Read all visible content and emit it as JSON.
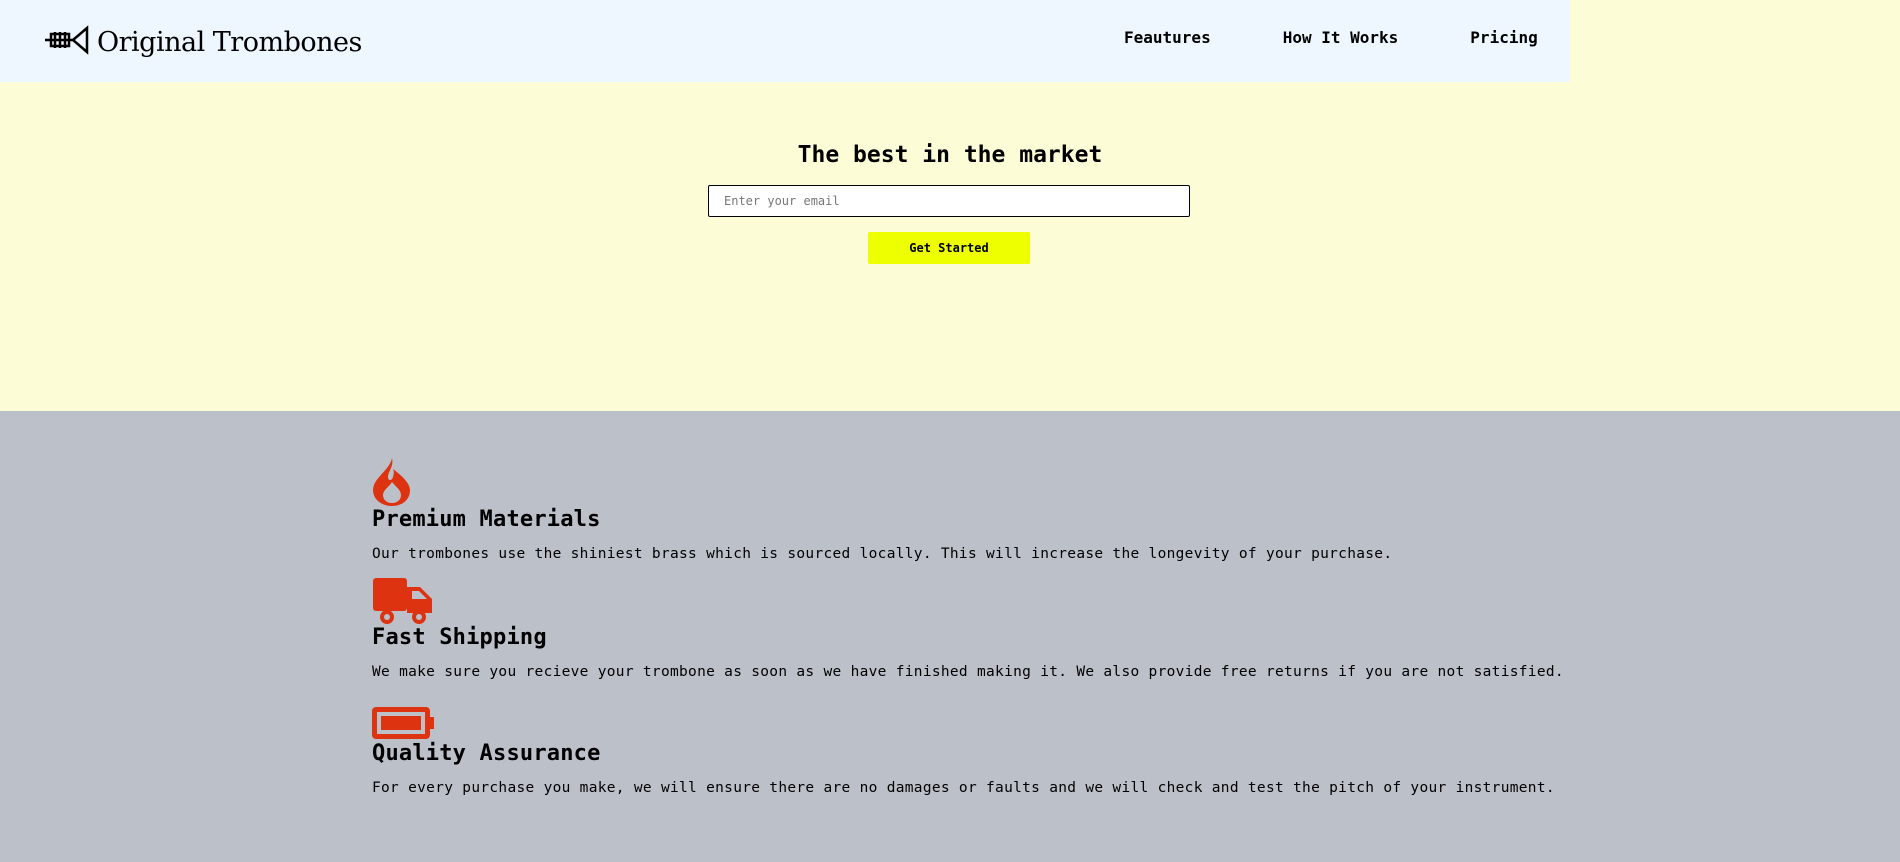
{
  "header": {
    "logo_text": "Original Trombones",
    "nav": [
      "Feautures",
      "How It Works",
      "Pricing"
    ]
  },
  "hero": {
    "title": "The best in the market",
    "email_placeholder": "Enter your email",
    "cta_label": "Get Started"
  },
  "features": [
    {
      "icon": "fire-icon",
      "title": "Premium Materials",
      "text": "Our trombones use the shiniest brass which is sourced locally. This will increase the longevity of your purchase."
    },
    {
      "icon": "truck-icon",
      "title": "Fast Shipping",
      "text": "We make sure you recieve your trombone as soon as we have finished making it. We also provide free returns if you are not satisfied."
    },
    {
      "icon": "battery-icon",
      "title": "Quality Assurance",
      "text": "For every purchase you make, we will ensure there are no damages or faults and we will check and test the pitch of your instrument."
    }
  ],
  "colors": {
    "header_bg": "#eef6ff",
    "hero_bg": "#fcfcd6",
    "features_bg": "#bcc0c9",
    "accent_button": "#eeff00",
    "icon_color": "#dd3311"
  }
}
